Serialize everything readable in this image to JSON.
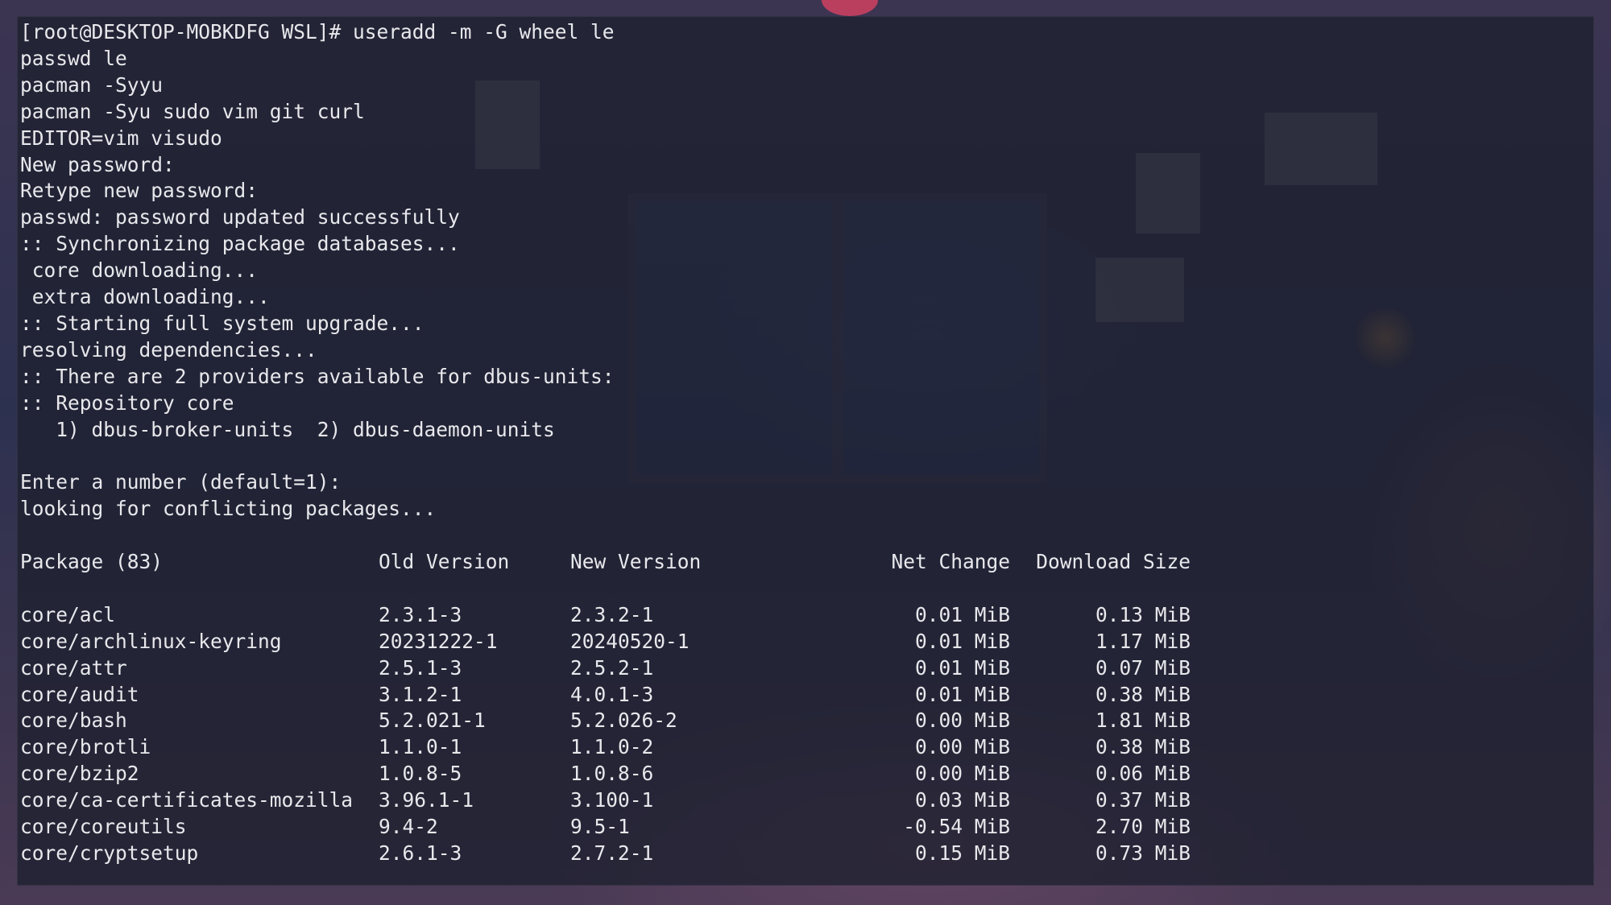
{
  "terminal": {
    "lines": [
      "[root@DESKTOP-MOBKDFG WSL]# useradd -m -G wheel le",
      "passwd le",
      "pacman -Syyu",
      "pacman -Syu sudo vim git curl",
      "EDITOR=vim visudo",
      "New password:",
      "Retype new password:",
      "passwd: password updated successfully",
      ":: Synchronizing package databases...",
      " core downloading...",
      " extra downloading...",
      ":: Starting full system upgrade...",
      "resolving dependencies...",
      ":: There are 2 providers available for dbus-units:",
      ":: Repository core",
      "   1) dbus-broker-units  2) dbus-daemon-units",
      "",
      "Enter a number (default=1):",
      "looking for conflicting packages..."
    ],
    "table": {
      "headers": [
        "Package (83)",
        "Old Version",
        "New Version",
        "Net Change",
        "Download Size"
      ],
      "rows": [
        [
          "core/acl",
          "2.3.1-3",
          "2.3.2-1",
          "0.01 MiB",
          "0.13 MiB"
        ],
        [
          "core/archlinux-keyring",
          "20231222-1",
          "20240520-1",
          "0.01 MiB",
          "1.17 MiB"
        ],
        [
          "core/attr",
          "2.5.1-3",
          "2.5.2-1",
          "0.01 MiB",
          "0.07 MiB"
        ],
        [
          "core/audit",
          "3.1.2-1",
          "4.0.1-3",
          "0.01 MiB",
          "0.38 MiB"
        ],
        [
          "core/bash",
          "5.2.021-1",
          "5.2.026-2",
          "0.00 MiB",
          "1.81 MiB"
        ],
        [
          "core/brotli",
          "1.1.0-1",
          "1.1.0-2",
          "0.00 MiB",
          "0.38 MiB"
        ],
        [
          "core/bzip2",
          "1.0.8-5",
          "1.0.8-6",
          "0.00 MiB",
          "0.06 MiB"
        ],
        [
          "core/ca-certificates-mozilla",
          "3.96.1-1",
          "3.100-1",
          "0.03 MiB",
          "0.37 MiB"
        ],
        [
          "core/coreutils",
          "9.4-2",
          "9.5-1",
          "-0.54 MiB",
          "2.70 MiB"
        ],
        [
          "core/cryptsetup",
          "2.6.1-3",
          "2.7.2-1",
          "0.15 MiB",
          "0.73 MiB"
        ]
      ]
    }
  },
  "colors": {
    "text": "#e8e8ec",
    "terminal_bg": "rgba(30, 32, 48, 0.80)"
  }
}
